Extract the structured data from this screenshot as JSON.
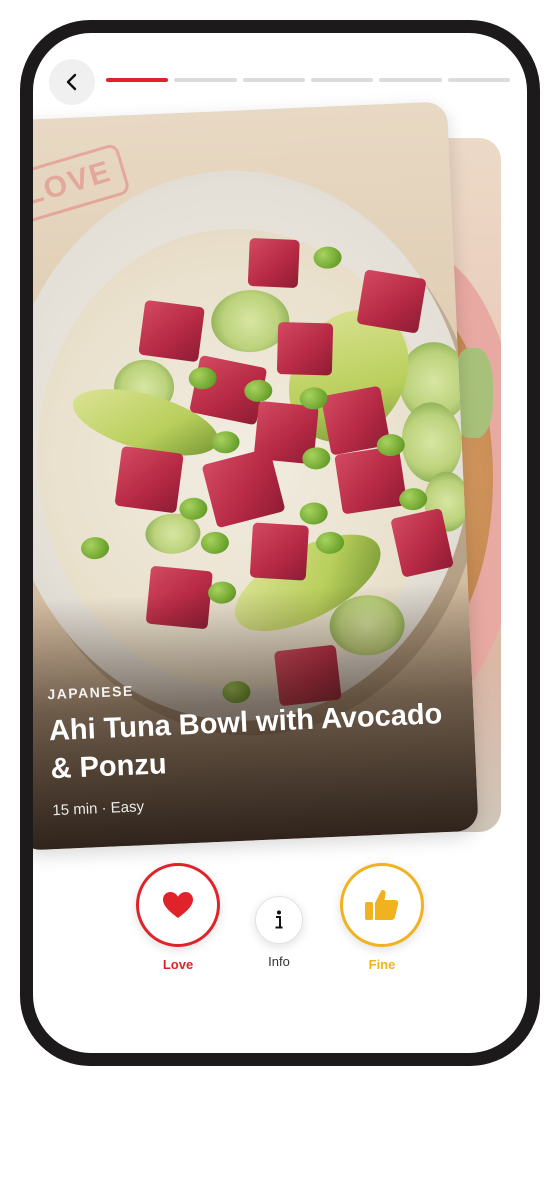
{
  "nav": {
    "back_icon": "chevron-left-icon"
  },
  "progress": {
    "total_steps": 6,
    "current_step": 1,
    "active_color": "#e0232b"
  },
  "card": {
    "stamp": "LOVE",
    "cuisine": "JAPANESE",
    "title": "Ahi Tuna Bowl with Avocado & Ponzu",
    "meta": "15 min · Easy"
  },
  "actions": {
    "love": {
      "label": "Love",
      "icon": "heart-icon",
      "color": "#e0232b"
    },
    "info": {
      "label": "Info",
      "icon": "info-icon"
    },
    "fine": {
      "label": "Fine",
      "icon": "thumbs-up-icon",
      "color": "#f0b31f"
    }
  }
}
